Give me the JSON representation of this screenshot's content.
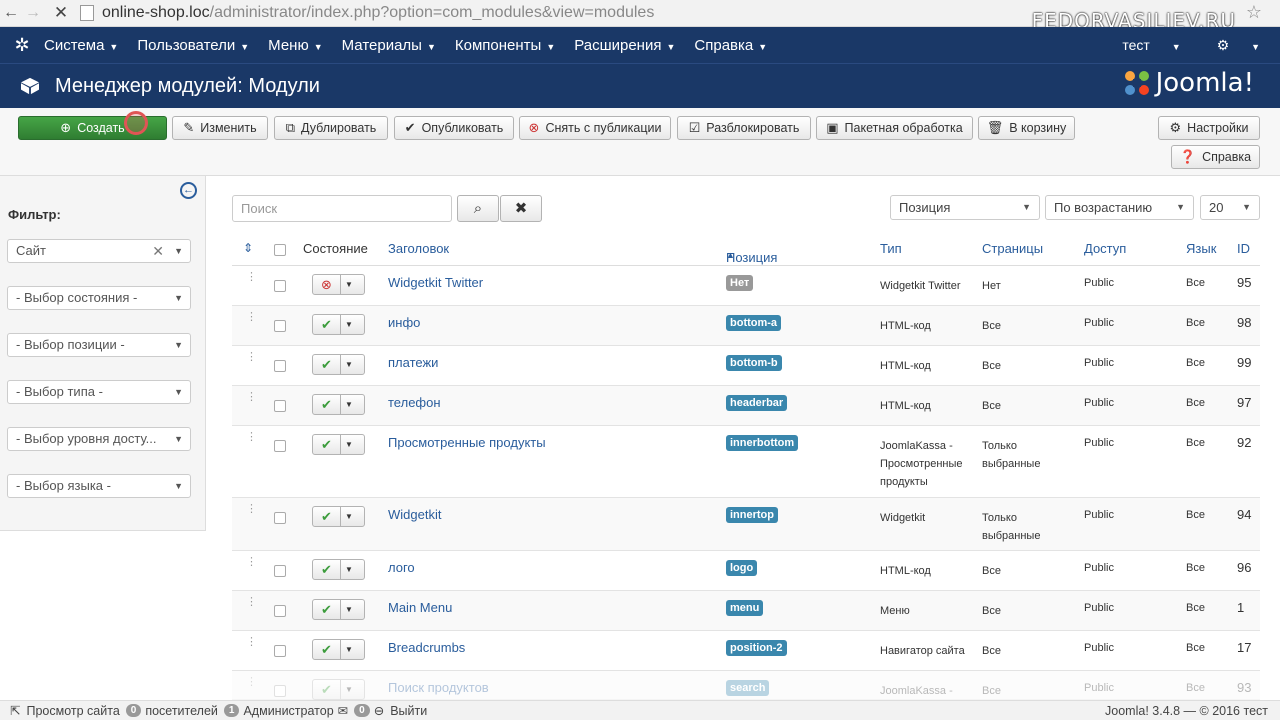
{
  "browser": {
    "url_host": "online-shop.loc",
    "url_path": "/administrator/index.php?option=com_modules&view=modules",
    "watermark": "FEDORVASILIEV.RU"
  },
  "menu": {
    "items": [
      "Система",
      "Пользователи",
      "Меню",
      "Материалы",
      "Компоненты",
      "Расширения",
      "Справка"
    ],
    "user": "тест"
  },
  "title": "Менеджер модулей: Модули",
  "brand": "Joomla!",
  "toolbar": {
    "create": "Создать",
    "edit": "Изменить",
    "duplicate": "Дублировать",
    "publish": "Опубликовать",
    "unpublish": "Снять с публикации",
    "checkin": "Разблокировать",
    "batch": "Пакетная обработка",
    "trash": "В корзину",
    "options": "Настройки",
    "help": "Справка"
  },
  "sidebar": {
    "filter_label": "Фильтр:",
    "site": "Сайт",
    "state": "- Выбор состояния -",
    "position": "- Выбор позиции -",
    "type": "- Выбор типа -",
    "level": "- Выбор уровня досту...",
    "language": "- Выбор языка -"
  },
  "list": {
    "search_placeholder": "Поиск",
    "ordering": "Позиция",
    "direction": "По возрастанию",
    "limit": "20"
  },
  "columns": {
    "state": "Состояние",
    "title": "Заголовок",
    "position": "Позиция",
    "type": "Тип",
    "pages": "Страницы",
    "access": "Доступ",
    "language": "Язык",
    "id": "ID"
  },
  "rows": [
    {
      "title": "Widgetkit Twitter",
      "position": "Нет",
      "type": "Widgetkit Twitter",
      "pages": "Нет",
      "access": "Public",
      "language": "Все",
      "id": "95"
    },
    {
      "title": "инфо",
      "position": "bottom-a",
      "type": "HTML-код",
      "pages": "Все",
      "access": "Public",
      "language": "Все",
      "id": "98"
    },
    {
      "title": "платежи",
      "position": "bottom-b",
      "type": "HTML-код",
      "pages": "Все",
      "access": "Public",
      "language": "Все",
      "id": "99"
    },
    {
      "title": "телефон",
      "position": "headerbar",
      "type": "HTML-код",
      "pages": "Все",
      "access": "Public",
      "language": "Все",
      "id": "97"
    },
    {
      "title": "Просмотренные продукты",
      "position": "innerbottom",
      "type": "JoomlaKassa - Просмотренные продукты",
      "pages": "Только выбранные",
      "access": "Public",
      "language": "Все",
      "id": "92"
    },
    {
      "title": "Widgetkit",
      "position": "innertop",
      "type": "Widgetkit",
      "pages": "Только выбранные",
      "access": "Public",
      "language": "Все",
      "id": "94"
    },
    {
      "title": "лого",
      "position": "logo",
      "type": "HTML-код",
      "pages": "Все",
      "access": "Public",
      "language": "Все",
      "id": "96"
    },
    {
      "title": "Main Menu",
      "position": "menu",
      "type": "Меню",
      "pages": "Все",
      "access": "Public",
      "language": "Все",
      "id": "1"
    },
    {
      "title": "Breadcrumbs",
      "position": "position-2",
      "type": "Навигатор сайта",
      "pages": "Все",
      "access": "Public",
      "language": "Все",
      "id": "17"
    },
    {
      "title": "Поиск продуктов",
      "position": "search",
      "type": "JoomlaKassa -",
      "pages": "Все",
      "access": "Public",
      "language": "Все",
      "id": "93"
    }
  ],
  "status": {
    "view_site": "Просмотр сайта",
    "visitors_count": "0",
    "visitors": "посетителей",
    "admins_count": "1",
    "admins": "Администратор",
    "messages_count": "0",
    "logout": "Выйти",
    "version": "Joomla! 3.4.8 — © 2016 тест"
  }
}
